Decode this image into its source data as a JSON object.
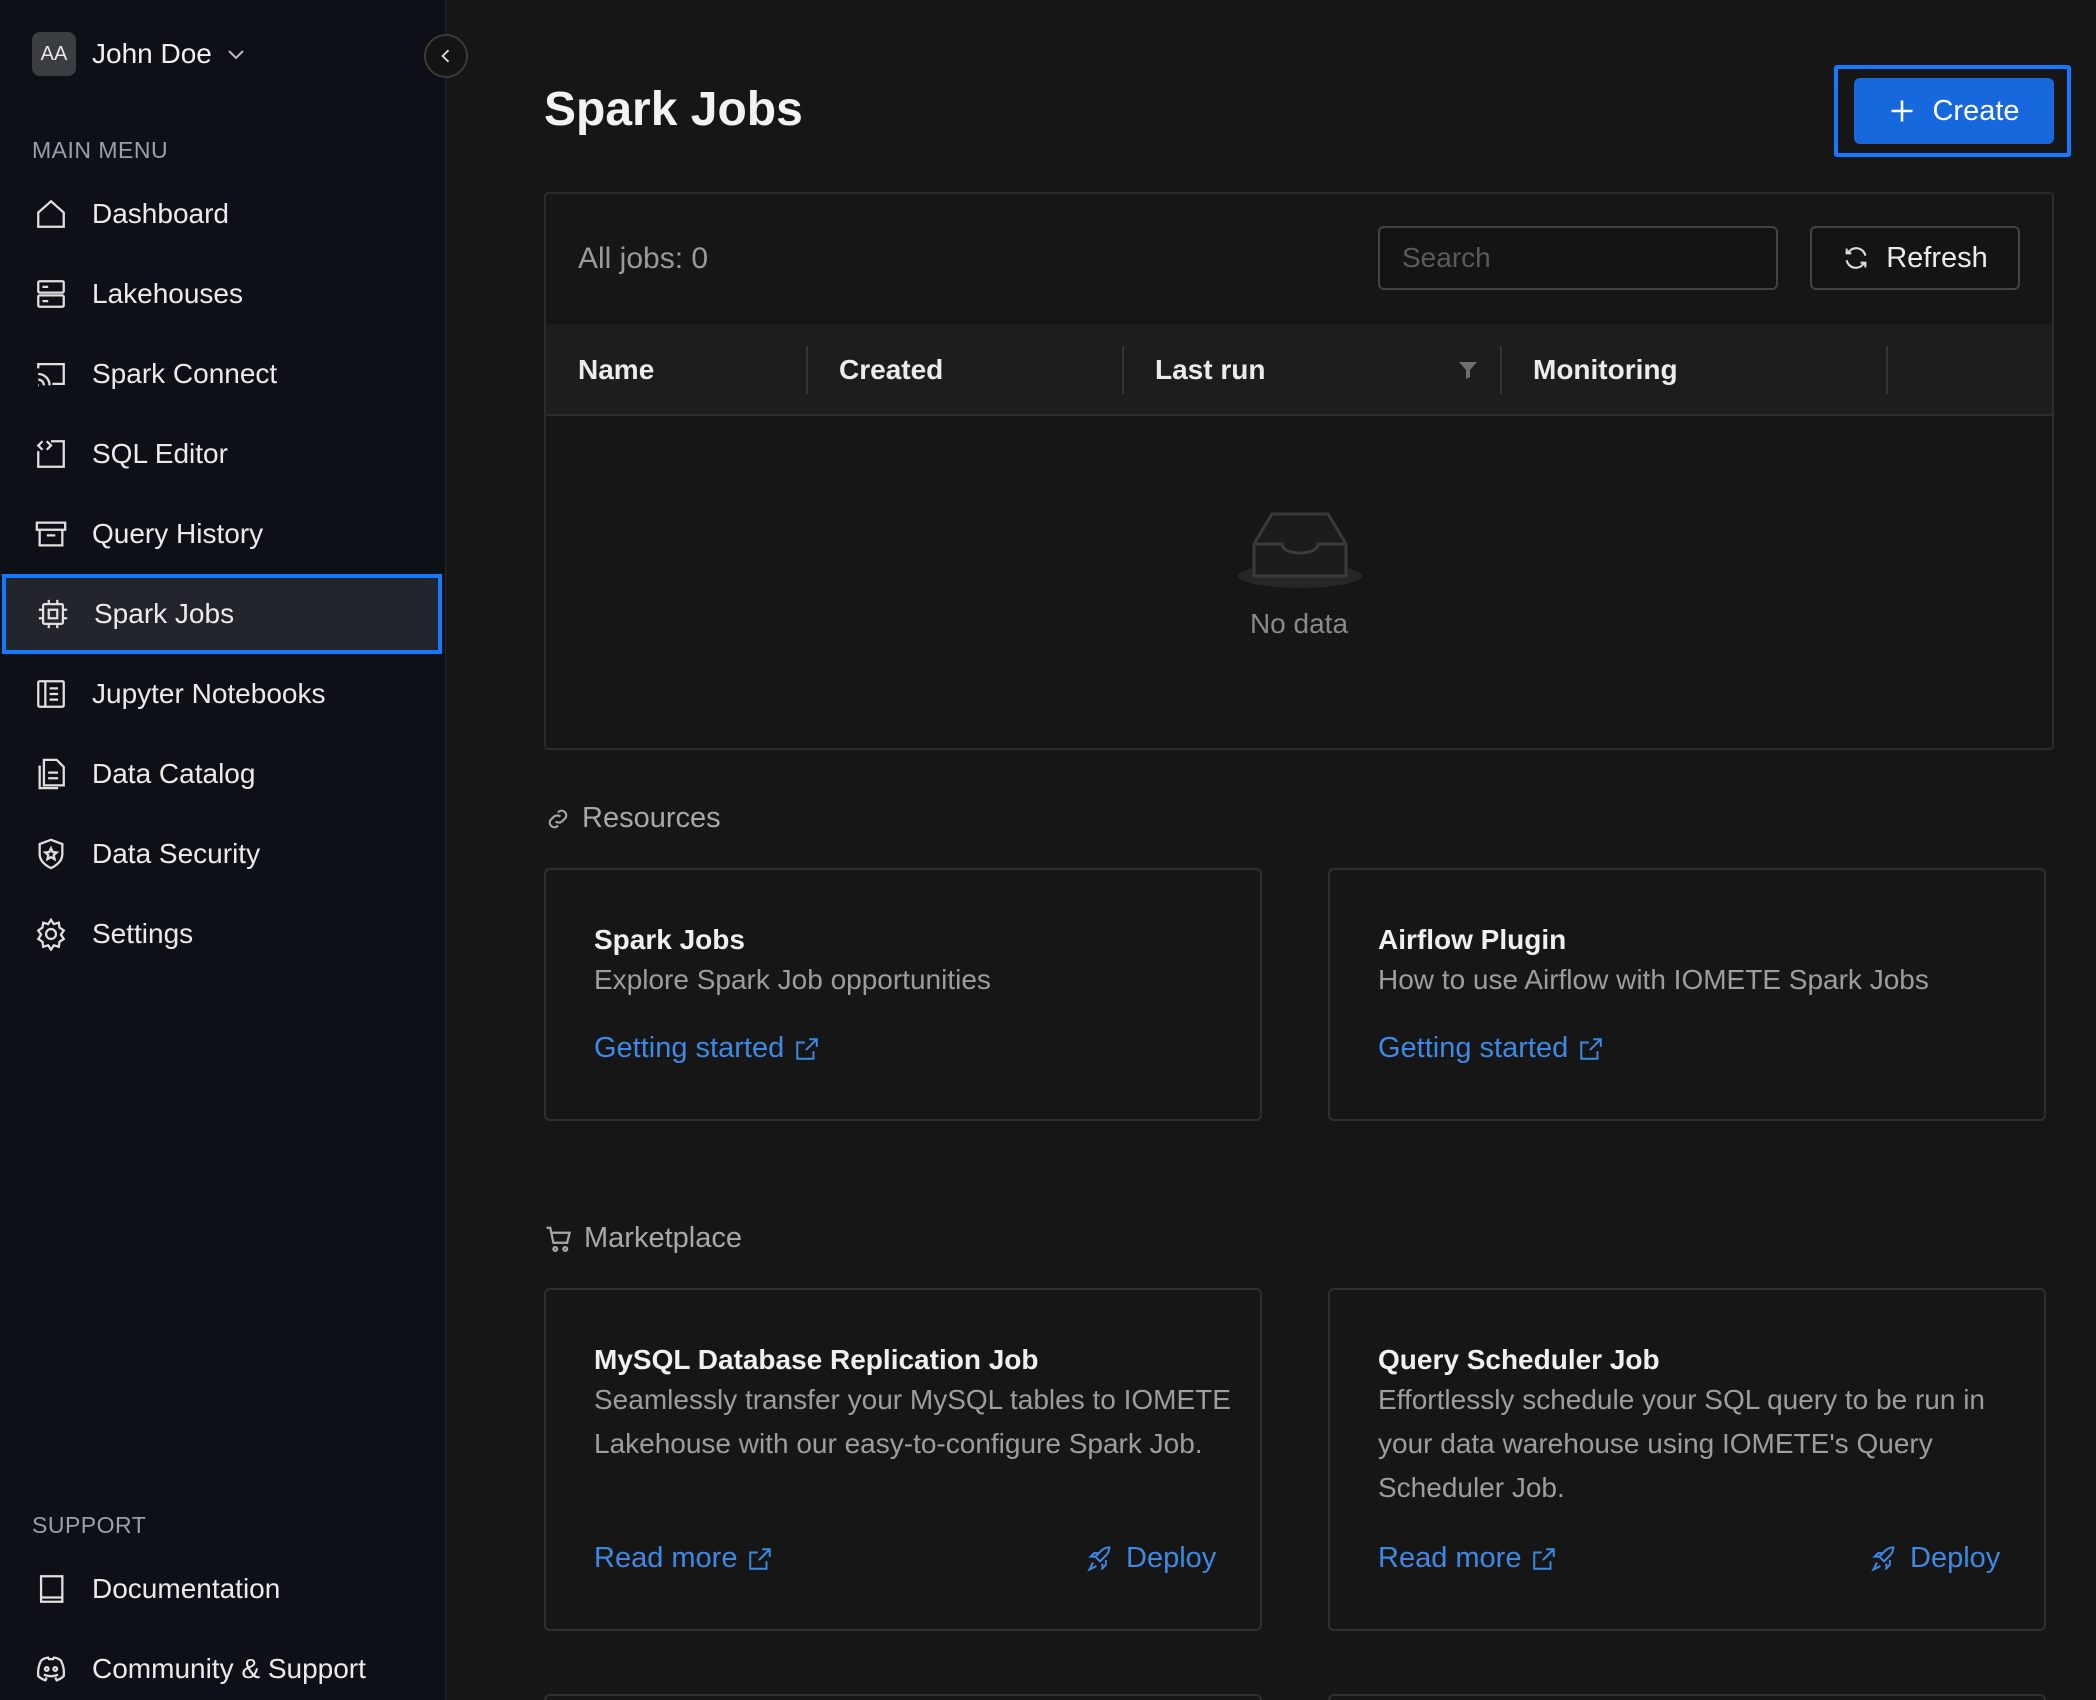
{
  "user": {
    "initials": "AA",
    "name": "John Doe"
  },
  "sidebar": {
    "main_menu_label": "MAIN MENU",
    "items": [
      {
        "label": "Dashboard",
        "icon": "home-icon"
      },
      {
        "label": "Lakehouses",
        "icon": "server-icon"
      },
      {
        "label": "Spark Connect",
        "icon": "cast-icon"
      },
      {
        "label": "SQL Editor",
        "icon": "code-editor-icon"
      },
      {
        "label": "Query History",
        "icon": "archive-icon"
      },
      {
        "label": "Spark Jobs",
        "icon": "chip-icon",
        "active": true
      },
      {
        "label": "Jupyter Notebooks",
        "icon": "notebook-icon"
      },
      {
        "label": "Data Catalog",
        "icon": "catalog-icon"
      },
      {
        "label": "Data Security",
        "icon": "shield-icon"
      },
      {
        "label": "Settings",
        "icon": "gear-icon"
      }
    ],
    "support_label": "SUPPORT",
    "support_items": [
      {
        "label": "Documentation",
        "icon": "book-icon"
      },
      {
        "label": "Community & Support",
        "icon": "discord-icon"
      }
    ]
  },
  "main": {
    "title": "Spark Jobs",
    "create_label": "Create",
    "all_jobs": "All jobs: 0",
    "search_placeholder": "Search",
    "refresh_label": "Refresh",
    "columns": [
      "Name",
      "Created",
      "Last run",
      "Monitoring"
    ],
    "empty_text": "No data"
  },
  "resources": {
    "heading": "Resources",
    "cards": [
      {
        "title": "Spark Jobs",
        "desc": "Explore Spark Job opportunities",
        "link": "Getting started"
      },
      {
        "title": "Airflow Plugin",
        "desc": "How to use Airflow with IOMETE Spark Jobs",
        "link": "Getting started"
      }
    ]
  },
  "marketplace": {
    "heading": "Marketplace",
    "cards": [
      {
        "title": "MySQL Database Replication Job",
        "desc": "Seamlessly transfer your MySQL tables to IOMETE Lakehouse with our easy-to-configure Spark Job.",
        "read_more": "Read more",
        "deploy": "Deploy"
      },
      {
        "title": "Query Scheduler Job",
        "desc": "Effortlessly schedule your SQL query to be run in your data warehouse using IOMETE's Query Scheduler Job.",
        "read_more": "Read more",
        "deploy": "Deploy"
      }
    ]
  },
  "colors": {
    "accent": "#1677ff",
    "link": "#3c89e8",
    "primary_button": "#1668dc"
  }
}
